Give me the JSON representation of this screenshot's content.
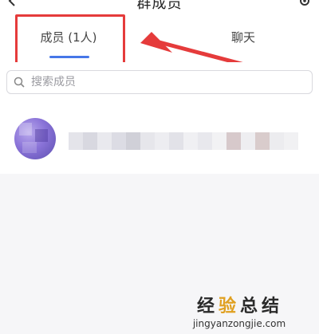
{
  "header": {
    "title": "群成员",
    "back_icon": "back-arrow-icon",
    "settings_icon": "gear-icon"
  },
  "tabs": [
    {
      "label": "成员 (1人)",
      "active": true
    },
    {
      "label": "聊天",
      "active": false
    }
  ],
  "search": {
    "placeholder": "搜索成员"
  },
  "members": [
    {
      "avatar": "avatar-image",
      "name": ""
    }
  ],
  "watermark": {
    "title_chars": [
      "经",
      "验",
      "总",
      "结"
    ],
    "url": "jingyanzongjie.com"
  },
  "colors": {
    "accent": "#4677e8",
    "annotation": "#e53b3b",
    "background": "#f6f6f8"
  }
}
